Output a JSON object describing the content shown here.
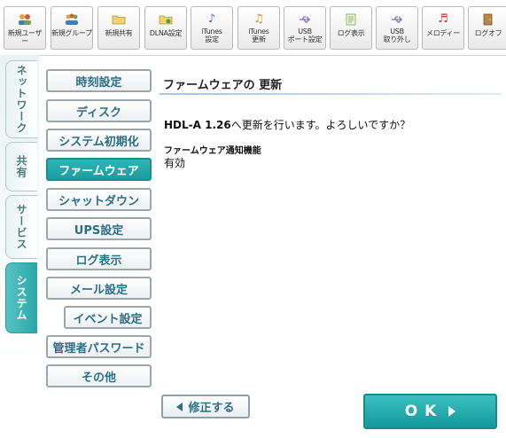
{
  "toolbar": {
    "items": [
      {
        "label": "新規ユーザー",
        "icon": "users-icon"
      },
      {
        "label": "新規グループ",
        "icon": "group-icon"
      },
      {
        "label": "新規共有",
        "icon": "folder-icon"
      },
      {
        "label": "DLNA設定",
        "icon": "dlna-folder-icon"
      },
      {
        "label": "iTunes\n設定",
        "icon": "music-note-icon"
      },
      {
        "label": "iTunes\n更新",
        "icon": "itunes-refresh-icon"
      },
      {
        "label": "USB\nポート設定",
        "icon": "usb-icon"
      },
      {
        "label": "ログ表示",
        "icon": "log-document-icon"
      },
      {
        "label": "USB\n取り外し",
        "icon": "usb-remove-icon"
      },
      {
        "label": "メロディー",
        "icon": "melody-icon"
      },
      {
        "label": "ログオフ",
        "icon": "logoff-icon"
      }
    ]
  },
  "tabs": [
    {
      "label": "ネットワーク"
    },
    {
      "label": "共有"
    },
    {
      "label": "サービス"
    },
    {
      "label": "システム",
      "active": true
    }
  ],
  "menu": [
    {
      "label": "時刻設定"
    },
    {
      "label": "ディスク"
    },
    {
      "label": "システム初期化"
    },
    {
      "label": "ファームウェア",
      "active": true
    },
    {
      "label": "シャットダウン"
    },
    {
      "label": "UPS設定"
    },
    {
      "label": "ログ表示"
    },
    {
      "label": "メール設定"
    },
    {
      "label": "イベント設定"
    },
    {
      "label": "管理者パスワード"
    },
    {
      "label": "その他"
    }
  ],
  "main": {
    "title": "ファームウェアの 更新",
    "version": "HDL-A 1.26",
    "confirm_text": "へ更新を行います。よろしいですか？",
    "notify_label": "ファームウェア通知機能",
    "notify_value": "有効",
    "back_label": "修正する",
    "ok_label": "OK"
  },
  "colors": {
    "accent": "#1c9ea1",
    "menu_text": "#2a6f88"
  }
}
